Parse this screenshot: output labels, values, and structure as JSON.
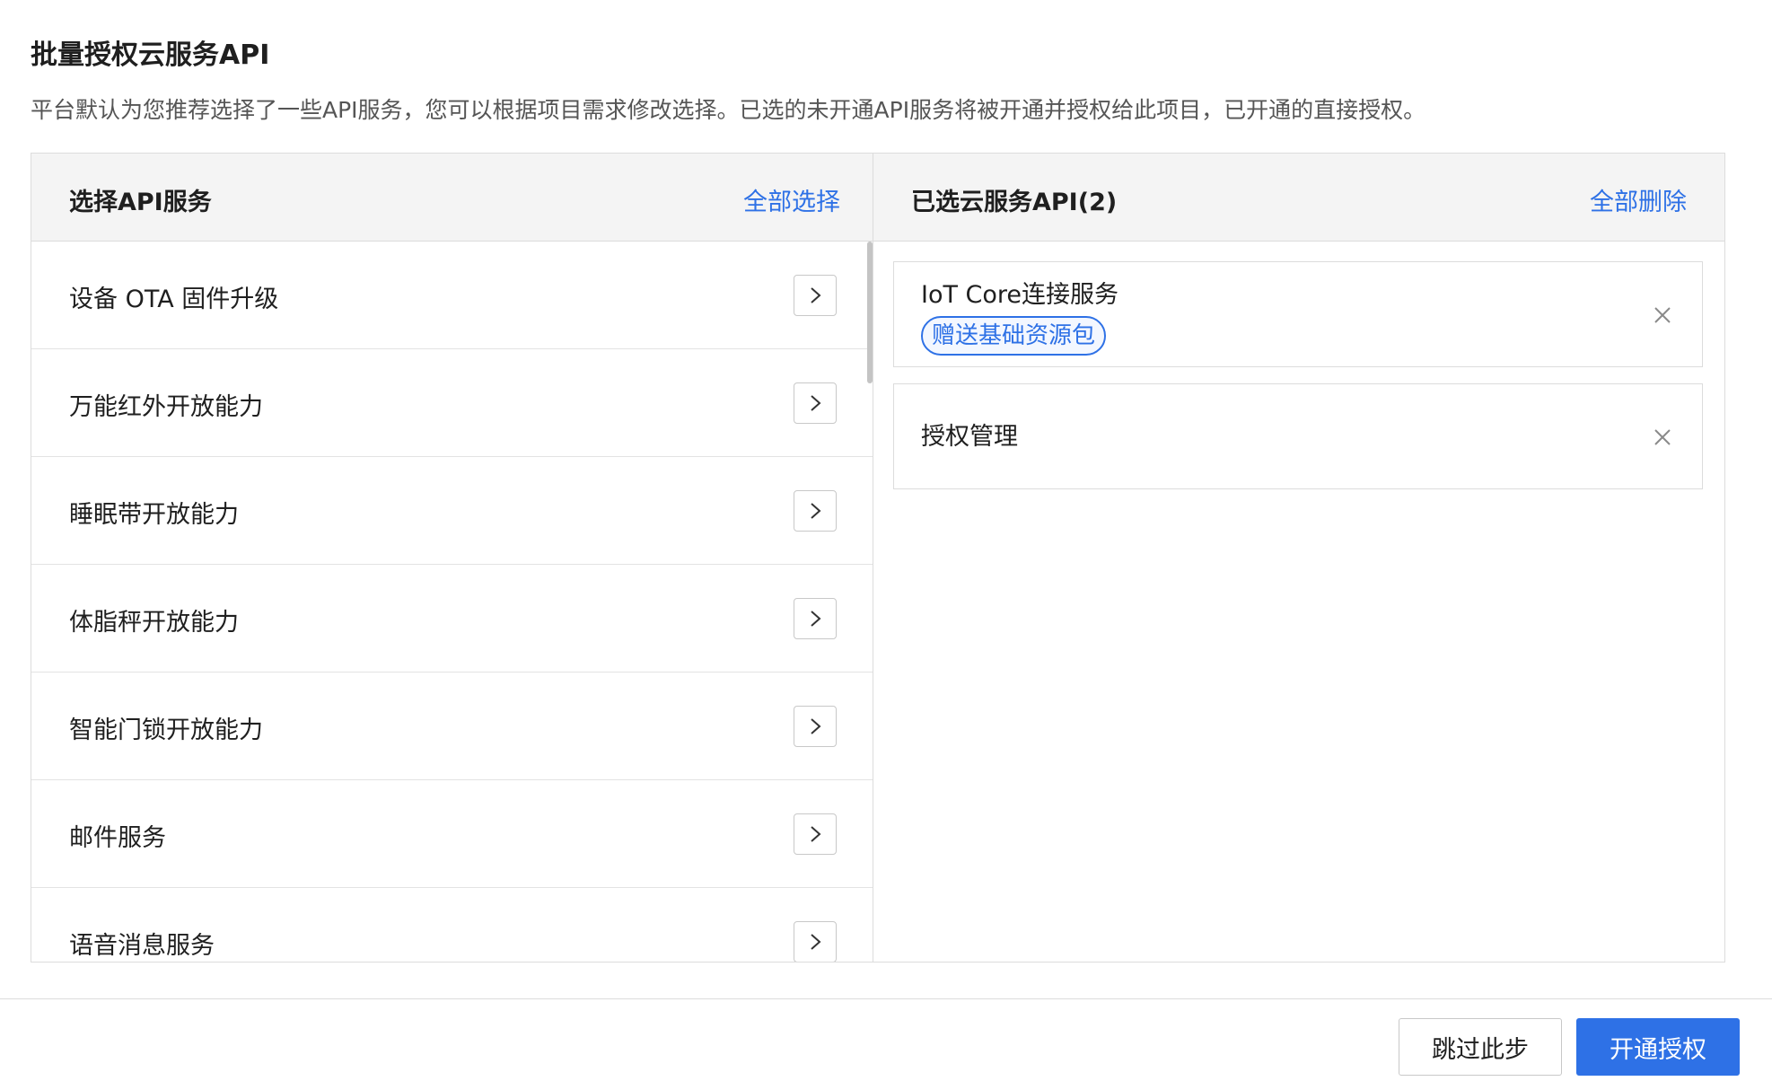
{
  "dialog": {
    "title": "批量授权云服务API",
    "description": "平台默认为您推荐选择了一些API服务，您可以根据项目需求修改选择。已选的未开通API服务将被开通并授权给此项目，已开通的直接授权。"
  },
  "left_panel": {
    "title": "选择API服务",
    "select_all": "全部选择",
    "items": [
      {
        "label": "设备 OTA 固件升级"
      },
      {
        "label": "万能红外开放能力"
      },
      {
        "label": "睡眠带开放能力"
      },
      {
        "label": "体脂秤开放能力"
      },
      {
        "label": "智能门锁开放能力"
      },
      {
        "label": "邮件服务"
      },
      {
        "label": "语音消息服务"
      }
    ]
  },
  "right_panel": {
    "title": "已选云服务API(2)",
    "delete_all": "全部删除",
    "selected": [
      {
        "name": "IoT Core连接服务",
        "tag": "赠送基础资源包"
      },
      {
        "name": "授权管理"
      }
    ]
  },
  "footer": {
    "skip_label": "跳过此步",
    "confirm_label": "开通授权"
  },
  "colors": {
    "accent": "#2e71e6",
    "header_bg": "#f4f4f4",
    "border": "#dcdcdc"
  }
}
